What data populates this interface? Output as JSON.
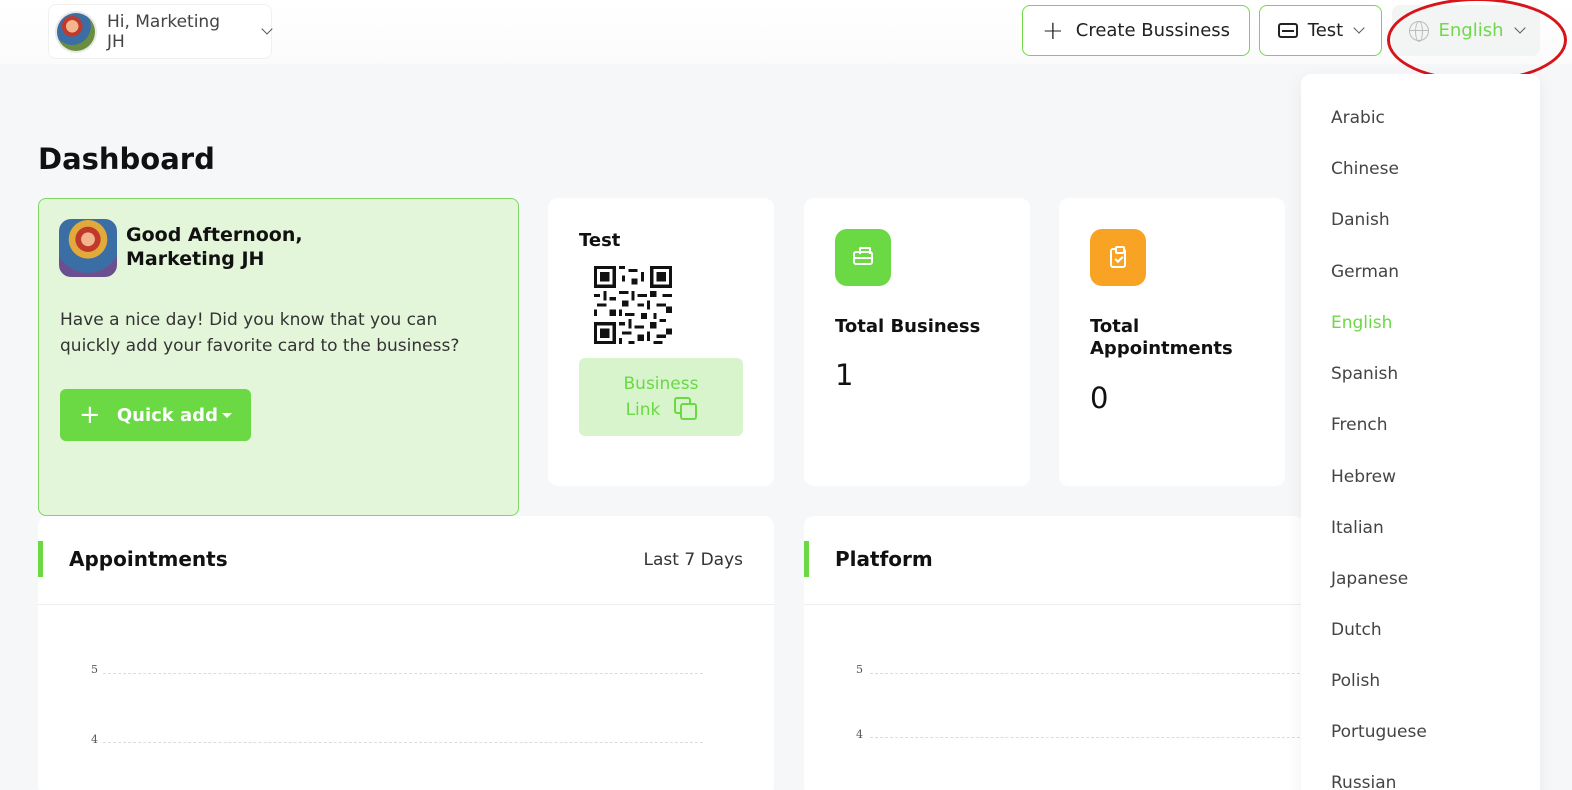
{
  "header": {
    "user_greeting": "Hi, Marketing JH",
    "create_business_label": "Create Bussiness",
    "business_selector_label": "Test",
    "language_label": "English"
  },
  "page": {
    "title": "Dashboard"
  },
  "welcome": {
    "greeting_line1": "Good Afternoon,",
    "greeting_line2": "Marketing JH",
    "message": "Have a nice day! Did you know that you can quickly add your favorite card to the business?",
    "quick_add_label": "Quick add"
  },
  "business_card": {
    "name": "Test",
    "link_label_line1": "Business",
    "link_label_line2": "Link"
  },
  "stats": {
    "total_business_label": "Total Business",
    "total_business_value": "1",
    "total_appointments_label_line1": "Total",
    "total_appointments_label_line2": "Appointments",
    "total_appointments_value": "0"
  },
  "appointments_panel": {
    "title": "Appointments",
    "range": "Last 7 Days",
    "y_ticks": [
      "5",
      "4"
    ]
  },
  "platform_panel": {
    "title": "Platform",
    "y_ticks": [
      "5",
      "4"
    ]
  },
  "language_menu": {
    "items": [
      "Arabic",
      "Chinese",
      "Danish",
      "German",
      "English",
      "Spanish",
      "French",
      "Hebrew",
      "Italian",
      "Japanese",
      "Dutch",
      "Polish",
      "Portuguese",
      "Russian"
    ],
    "selected": "English"
  },
  "colors": {
    "accent_green": "#6ad943",
    "accent_orange": "#f8a324",
    "highlight_red": "#d7141a"
  }
}
